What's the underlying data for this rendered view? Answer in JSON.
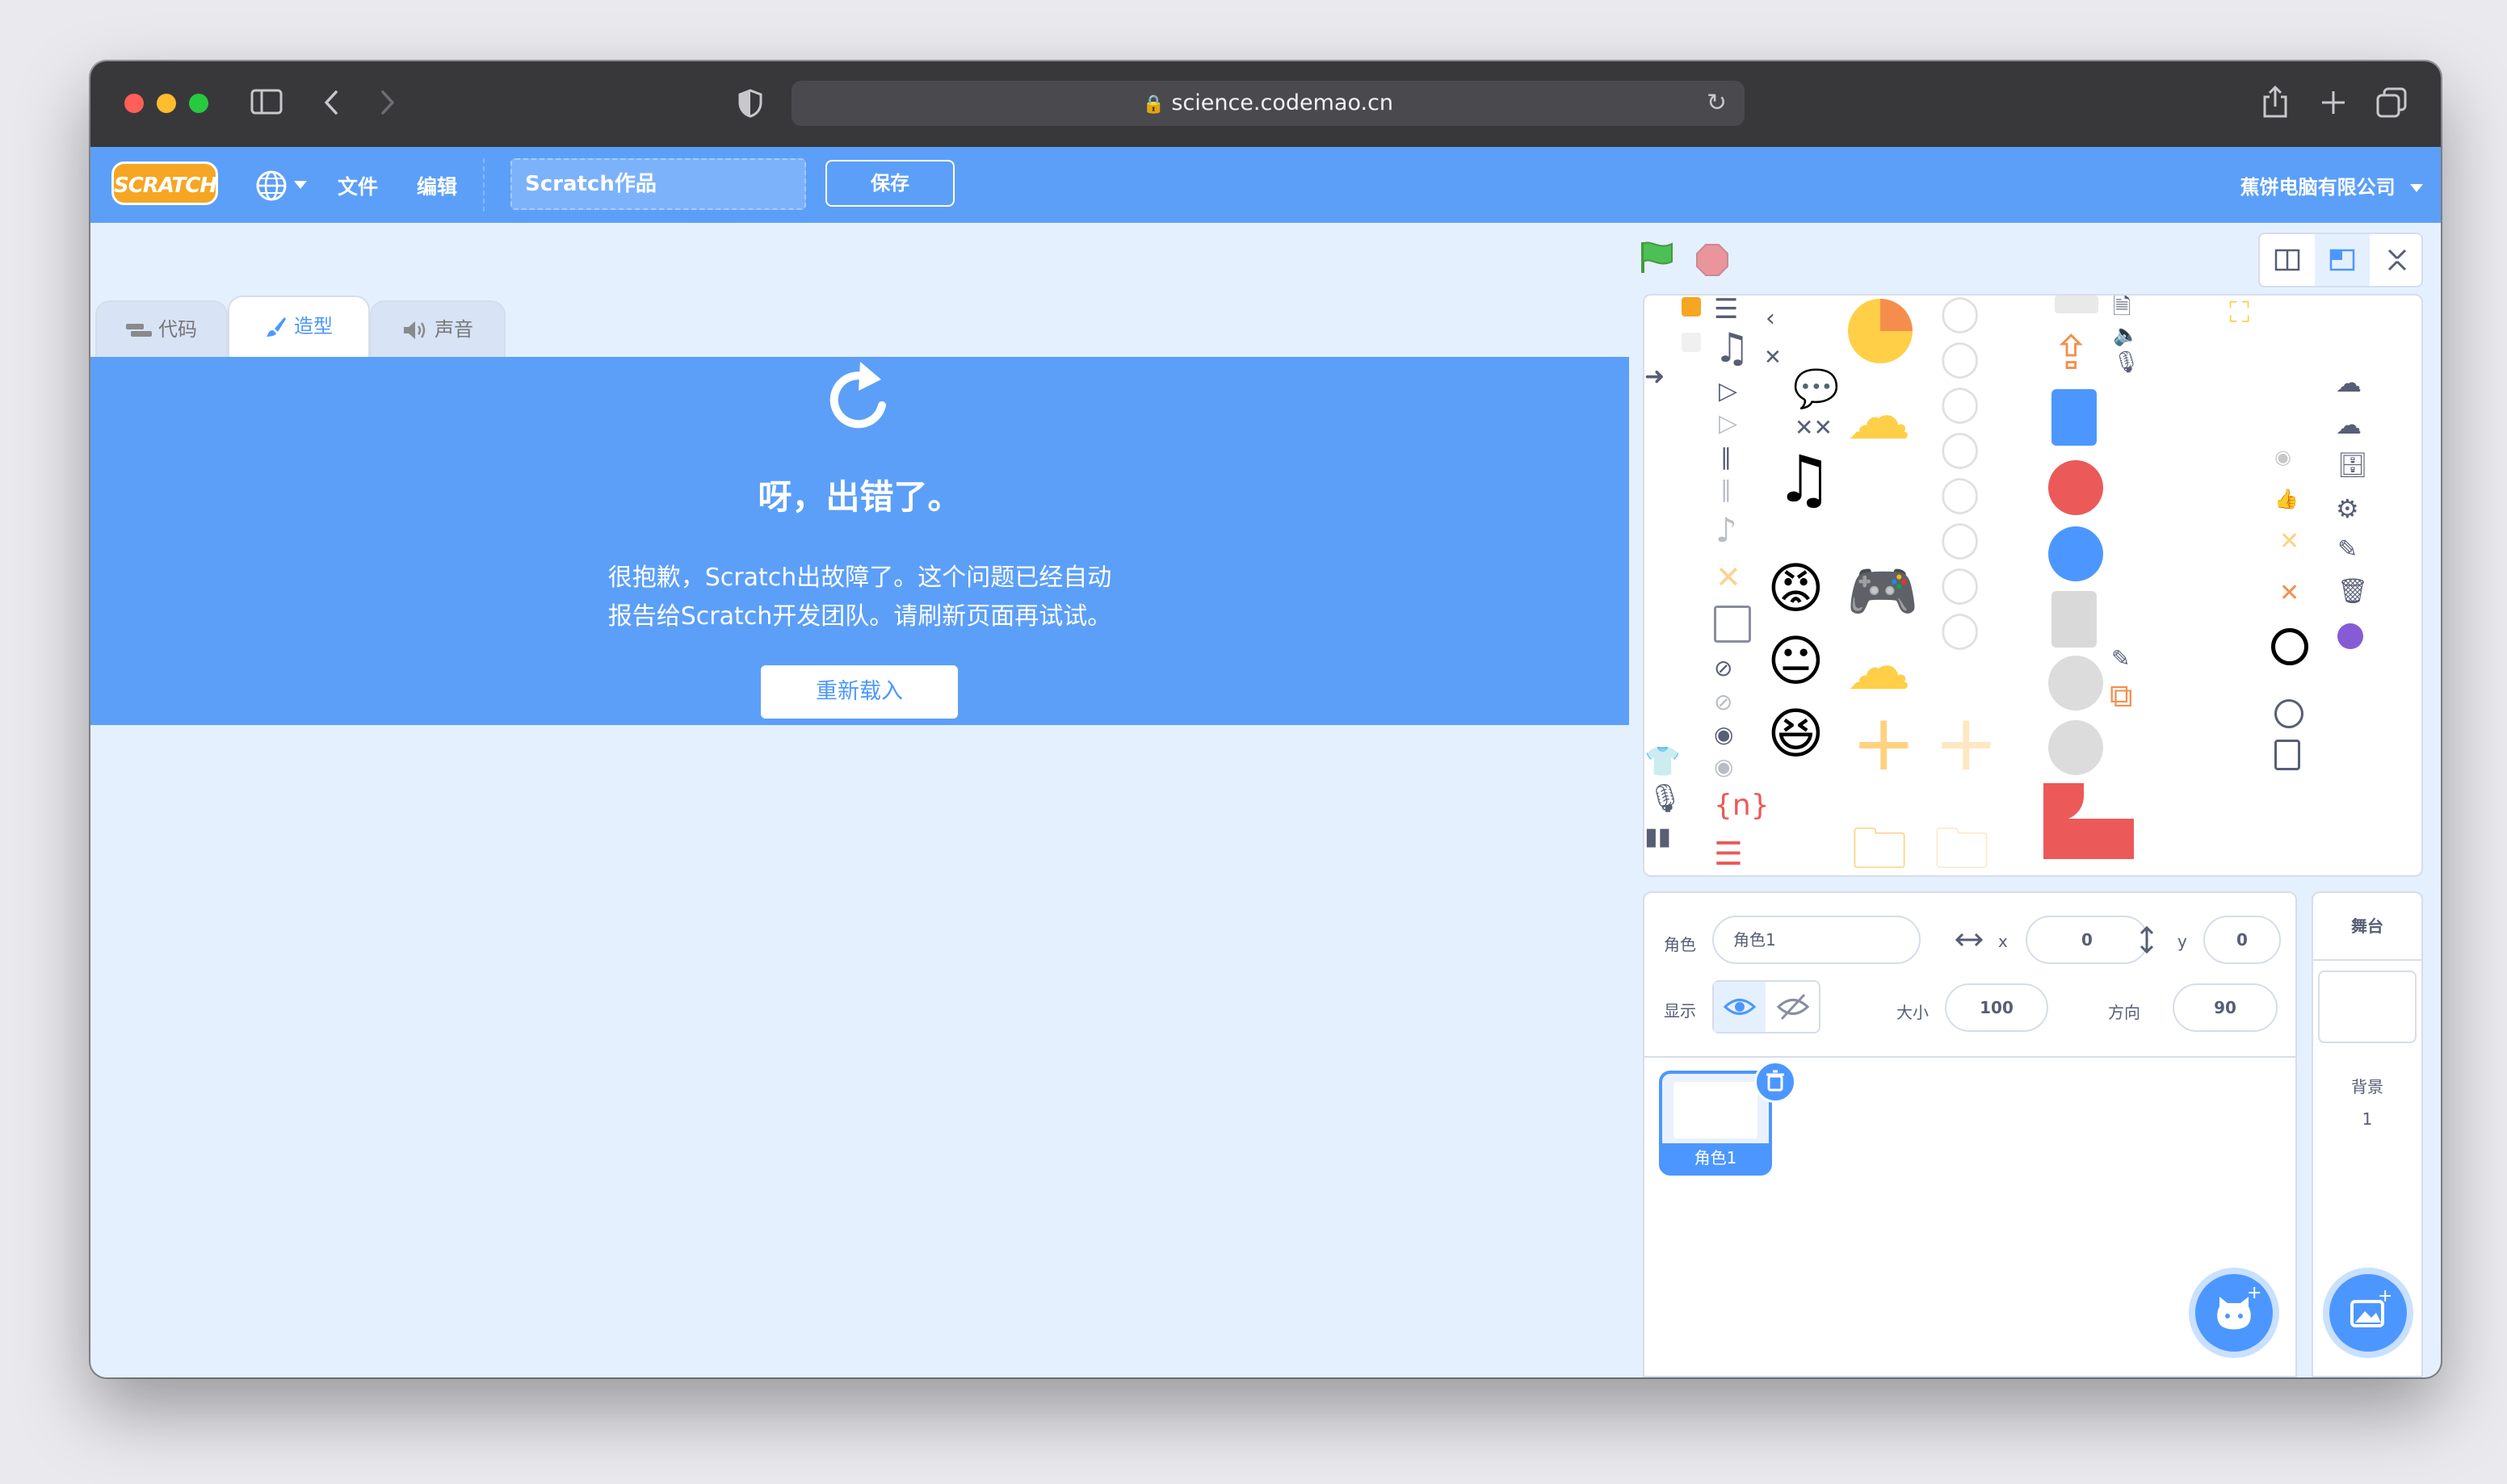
{
  "browser": {
    "url": "science.codemao.cn"
  },
  "menu": {
    "logo": "SCRATCH",
    "file": "文件",
    "edit": "编辑",
    "project_title": "Scratch作品",
    "save": "保存",
    "account": "蕉饼电脑有限公司"
  },
  "tabs": {
    "code": "代码",
    "costumes": "造型",
    "sounds": "声音"
  },
  "error": {
    "title": "呀，出错了。",
    "message_line1": "很抱歉，Scratch出故障了。这个问题已经自动",
    "message_line2": "报告给Scratch开发团队。请刷新页面再试试。",
    "reload": "重新载入"
  },
  "stage_glyphs": {
    "variable": "{n}"
  },
  "sprite_info": {
    "sprite_label": "角色",
    "sprite_name": "角色1",
    "x_label": "x",
    "x_value": "0",
    "y_label": "y",
    "y_value": "0",
    "show_label": "显示",
    "size_label": "大小",
    "size_value": "100",
    "direction_label": "方向",
    "direction_value": "90"
  },
  "sprites": [
    {
      "name": "角色1"
    }
  ],
  "stage_panel": {
    "title": "舞台",
    "backdrops_label": "背景",
    "backdrops_count": "1"
  },
  "colors": {
    "primary": "#4c97ff",
    "menu": "#5c9ff8",
    "background": "#e5f0ff"
  }
}
